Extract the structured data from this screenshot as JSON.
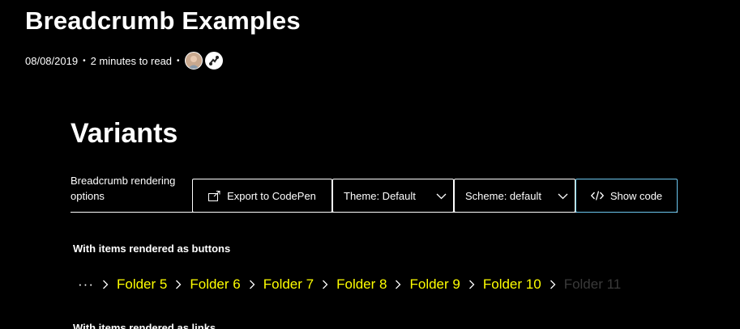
{
  "page": {
    "title": "Breadcrumb Examples",
    "date": "08/08/2019",
    "read_time": "2 minutes to read"
  },
  "section": {
    "title": "Variants"
  },
  "toolbar": {
    "label": "Breadcrumb rendering options",
    "export_label": "Export to CodePen",
    "theme_label": "Theme: Default",
    "scheme_label": "Scheme: default",
    "show_code_label": "Show code"
  },
  "examples": [
    {
      "label": "With items rendered as buttons",
      "overflow": "···",
      "items": [
        "Folder 5",
        "Folder 6",
        "Folder 7",
        "Folder 8",
        "Folder 9",
        "Folder 10"
      ],
      "current": "Folder 11"
    },
    {
      "label": "With items rendered as links"
    }
  ],
  "colors": {
    "background": "#000000",
    "text": "#ffffff",
    "link": "#ffff00",
    "current": "#3a3a3a",
    "focus_border": "#6cc7f0"
  },
  "icons": [
    "avatar-photo",
    "avatar-robot",
    "export-icon",
    "chevron-down-icon",
    "code-icon",
    "chevron-right-icon"
  ]
}
